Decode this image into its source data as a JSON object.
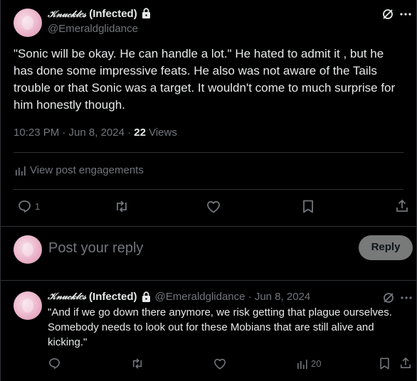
{
  "main_tweet": {
    "author_name": "Knuckles (Infected)",
    "author_name_styled": "𝒦𝓃𝓊𝒸𝓀𝓁𝑒𝓈",
    "author_suffix": "(Infected)",
    "handle": "@Emeraldglidance",
    "text": "\"Sonic will be okay. He can handle a lot.\"  He hated to admit it , but he has done some impressive feats.  He also was not aware of the Tails trouble or that Sonic was a target. It wouldn't come to much surprise for him honestly though.",
    "timestamp": "10:23 PM · Jun 8, 2024 · ",
    "views_count": "22",
    "views_label": " Views",
    "engagements_label": "View post engagements",
    "reply_count": "1"
  },
  "composer": {
    "placeholder": "Post your reply",
    "reply_button": "Reply"
  },
  "reply_tweet": {
    "author_name_styled": "𝒦𝓃𝓊𝒸𝓀𝓁𝑒𝓈",
    "author_suffix": "(Infected)",
    "handle_date": "@Emeraldglidance · Jun 8, 2024",
    "text": "\"And if we go down there anymore, we risk getting that plague ourselves. Somebody needs to look out for these Mobians that are still alive and kicking.\"",
    "views_count": "20"
  },
  "colors": {
    "background": "#000000",
    "text": "#e7e9ea",
    "muted": "#71767b",
    "divider": "#2f3336",
    "reply_button": "#787a7a"
  }
}
